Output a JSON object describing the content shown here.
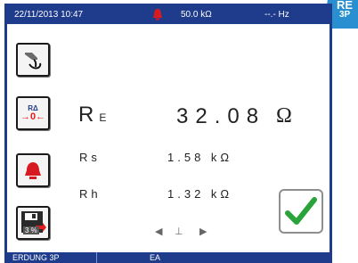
{
  "mode": {
    "title": "RE",
    "subtitle": "3P"
  },
  "status_bar": {
    "datetime": "22/11/2013 10:47",
    "range": "50.0 kΩ",
    "frequency": "--.- Hz"
  },
  "main": {
    "re_label": "R",
    "re_sub": "E",
    "re_value": "32.08",
    "re_unit": "Ω",
    "rs_label": "Rs",
    "rs_value": "1.58 kΩ",
    "rh_label": "Rh",
    "rh_value": "1.32 kΩ"
  },
  "buttons": {
    "zero_small": "RΔ",
    "zero_main": "→0←",
    "save_percent": "3 %"
  },
  "nav": {
    "left_arrow": "◀",
    "right_arrow": "▶",
    "symbol": "⊥"
  },
  "bottom_bar": {
    "left": "ERDUNG 3P",
    "right": "EA"
  },
  "colors": {
    "panel_blue": "#1f3b8c",
    "alarm_red": "#d71920",
    "check_green": "#2aa43a",
    "zero_red": "#e41b1b"
  },
  "icons": [
    "probe-icon",
    "zero-icon",
    "alarm-icon",
    "save-icon",
    "check-icon"
  ]
}
